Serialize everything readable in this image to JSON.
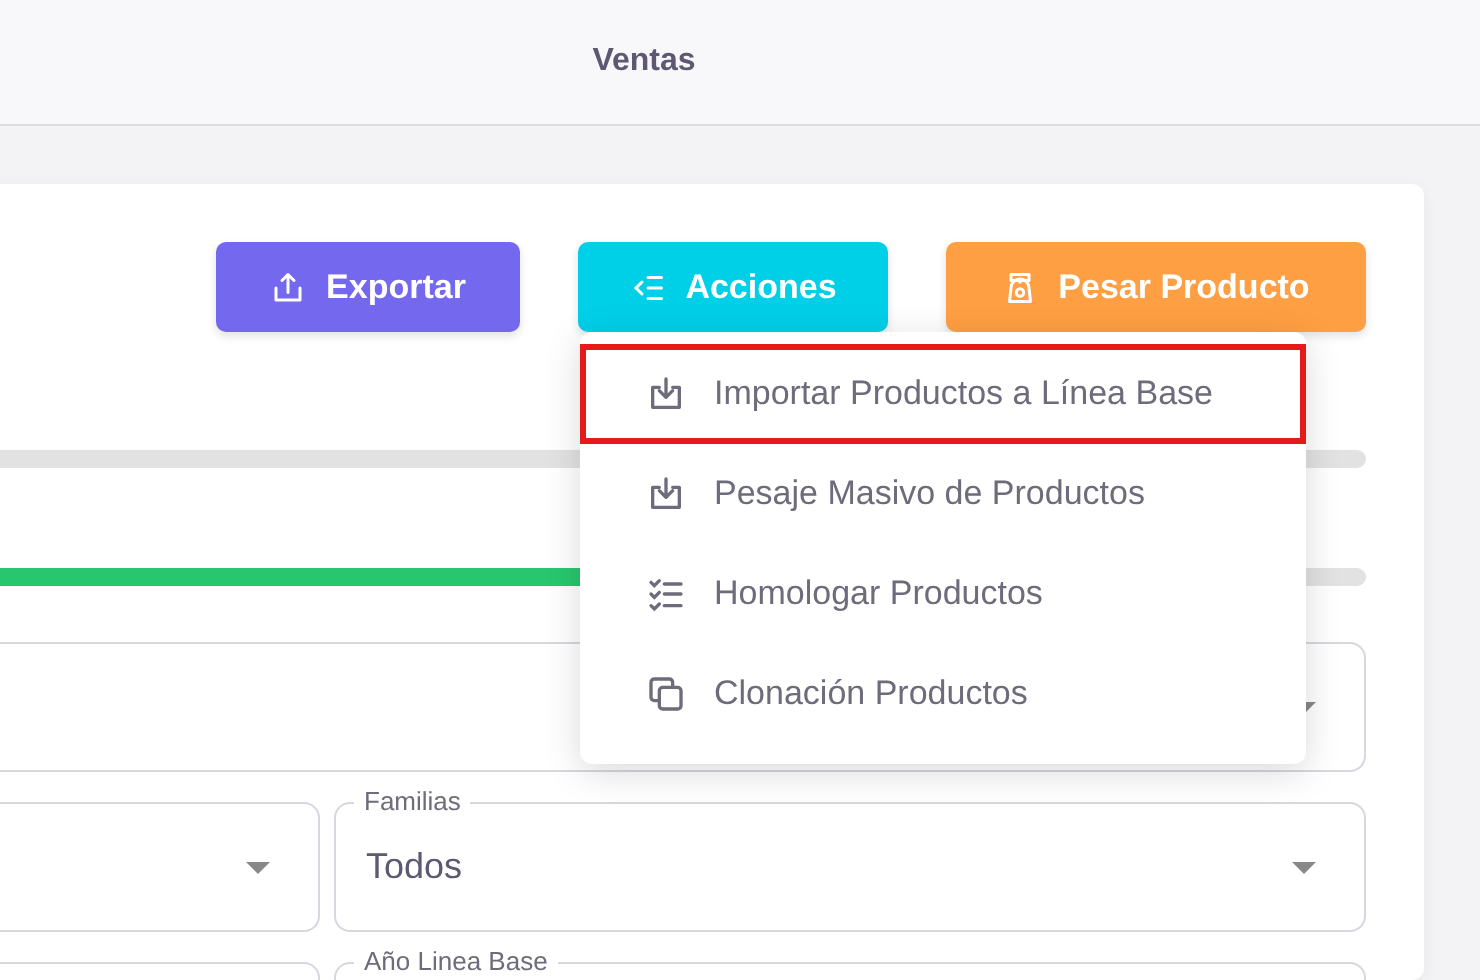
{
  "header": {
    "title": "Ventas"
  },
  "toolbar": [
    {
      "kind": "export",
      "label": "Exportar",
      "color": "#7468ee"
    },
    {
      "kind": "actions",
      "label": "Acciones",
      "color": "#00cfe8"
    },
    {
      "kind": "weigh",
      "label": "Pesar Producto",
      "color": "#ff9f43"
    }
  ],
  "progress": [
    {
      "kind": "empty"
    },
    {
      "kind": "filled",
      "level": 0.55
    }
  ],
  "filters": [
    {
      "kind": "wide"
    },
    {
      "kind": "half"
    },
    {
      "kind": "half",
      "label": "Familias",
      "value": "Todos"
    },
    {
      "kind": "half"
    },
    {
      "kind": "half",
      "label": "Año Linea Base"
    }
  ],
  "menu": {
    "items": [
      {
        "kind": "import",
        "label": "Importar Productos a Línea Base",
        "highlighted": true
      },
      {
        "kind": "import",
        "label": "Pesaje Masivo de Productos",
        "highlighted": false
      },
      {
        "kind": "checklist",
        "label": "Homologar Productos",
        "highlighted": false
      },
      {
        "kind": "copy",
        "label": "Clonación Productos",
        "highlighted": false
      }
    ]
  }
}
